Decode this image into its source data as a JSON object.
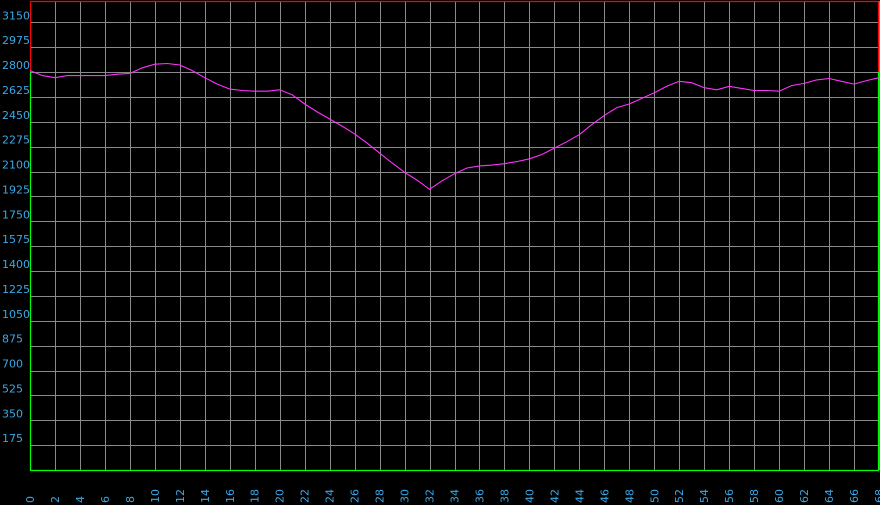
{
  "chart_data": {
    "type": "line",
    "xlim": [
      0,
      68
    ],
    "ylim": [
      0,
      3300
    ],
    "grid": true,
    "x_ticks": [
      0,
      2,
      4,
      6,
      8,
      10,
      12,
      14,
      16,
      18,
      20,
      22,
      24,
      26,
      28,
      30,
      32,
      34,
      36,
      38,
      40,
      42,
      44,
      46,
      48,
      50,
      52,
      54,
      56,
      58,
      60,
      62,
      64,
      66,
      68
    ],
    "y_ticks": [
      175,
      350,
      525,
      700,
      875,
      1050,
      1225,
      1400,
      1575,
      1750,
      1925,
      2100,
      2275,
      2450,
      2625,
      2800,
      2975,
      3150
    ],
    "band": {
      "upper_color": "#ff0000",
      "lower_color": "#00ff00",
      "value": 2800
    },
    "series": [
      {
        "color": "#ff33ff",
        "x": [
          0,
          1,
          2,
          3,
          4,
          5,
          6,
          7,
          8,
          9,
          10,
          11,
          12,
          13,
          14,
          15,
          16,
          17,
          18,
          19,
          20,
          21,
          22,
          23,
          24,
          25,
          26,
          27,
          28,
          29,
          30,
          31,
          32,
          33,
          34,
          35,
          36,
          37,
          38,
          39,
          40,
          41,
          42,
          43,
          44,
          45,
          46,
          47,
          48,
          49,
          50,
          51,
          52,
          53,
          54,
          55,
          56,
          57,
          58,
          59,
          60,
          61,
          62,
          63,
          64,
          65,
          66,
          67,
          68
        ],
        "y": [
          2810,
          2775,
          2760,
          2775,
          2775,
          2775,
          2775,
          2785,
          2790,
          2830,
          2855,
          2860,
          2850,
          2810,
          2760,
          2715,
          2680,
          2670,
          2665,
          2665,
          2675,
          2640,
          2575,
          2520,
          2470,
          2420,
          2365,
          2300,
          2230,
          2160,
          2095,
          2040,
          1975,
          2035,
          2085,
          2125,
          2140,
          2145,
          2155,
          2170,
          2190,
          2220,
          2265,
          2310,
          2360,
          2430,
          2495,
          2550,
          2575,
          2615,
          2655,
          2700,
          2735,
          2725,
          2690,
          2675,
          2700,
          2685,
          2670,
          2670,
          2665,
          2705,
          2720,
          2745,
          2755,
          2735,
          2715,
          2740,
          2760
        ]
      }
    ]
  }
}
